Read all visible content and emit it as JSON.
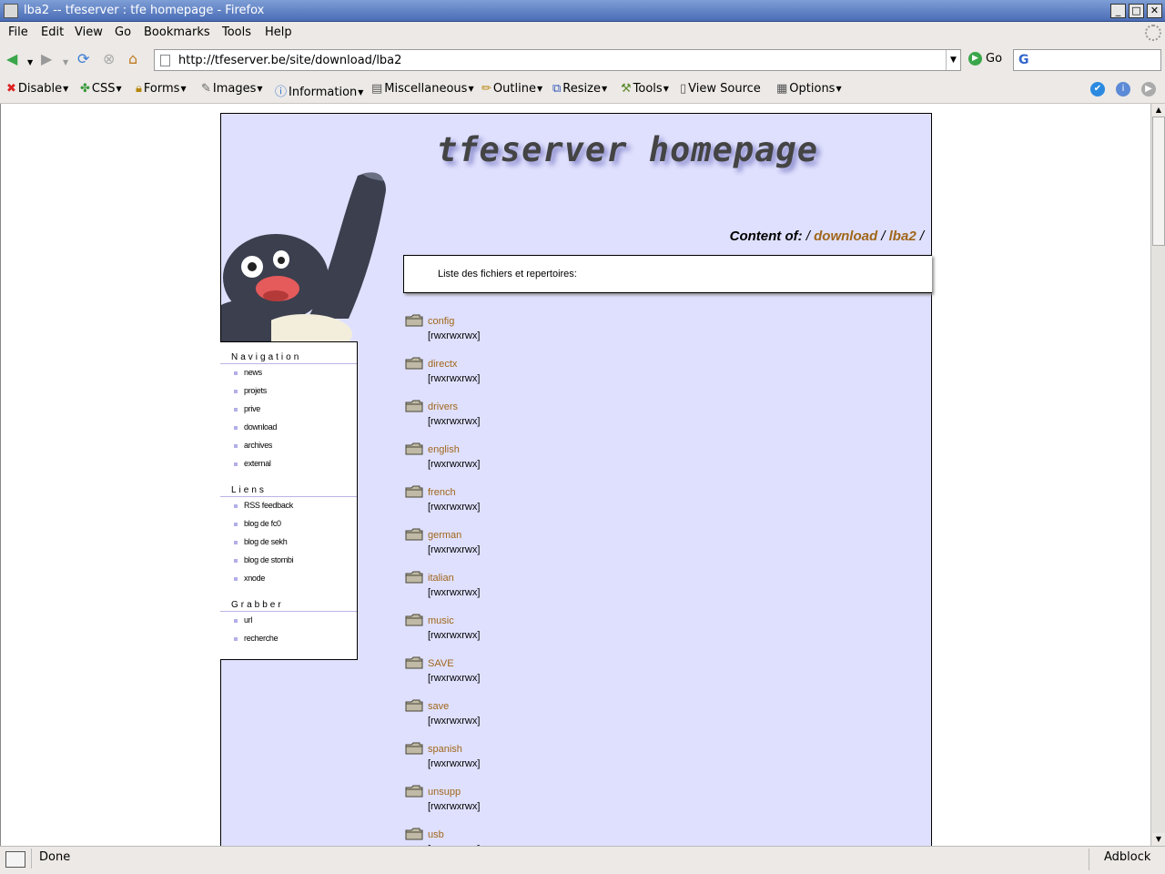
{
  "window": {
    "title": "lba2 -- tfeserver : tfe homepage - Firefox"
  },
  "menu": [
    "File",
    "Edit",
    "View",
    "Go",
    "Bookmarks",
    "Tools",
    "Help"
  ],
  "navbar": {
    "url": "http://tfeserver.be/site/download/lba2",
    "go_label": "Go",
    "search_engine_letter": "G"
  },
  "webdev_toolbar": [
    "Disable",
    "CSS",
    "Forms",
    "Images",
    "Information",
    "Miscellaneous",
    "Outline",
    "Resize",
    "Tools",
    "View Source",
    "Options"
  ],
  "page": {
    "site_title": "tfeserver homepage",
    "crumb_label": "Content of:",
    "crumb_links": [
      "download",
      "lba2"
    ],
    "list_header": "Liste des fichiers et repertoires:",
    "sidebar": {
      "sections": [
        {
          "title": "Navigation",
          "items": [
            "news",
            "projets",
            "prive",
            "download",
            "archives",
            "external"
          ]
        },
        {
          "title": "Liens",
          "items": [
            "RSS feedback",
            "blog de fc0",
            "blog de sekh",
            "blog de stombi",
            "xnode"
          ]
        },
        {
          "title": "Grabber",
          "items": [
            "url",
            "recherche"
          ]
        }
      ]
    },
    "files": [
      {
        "name": "config",
        "perm": "[rwxrwxrwx]"
      },
      {
        "name": "directx",
        "perm": "[rwxrwxrwx]"
      },
      {
        "name": "drivers",
        "perm": "[rwxrwxrwx]"
      },
      {
        "name": "english",
        "perm": "[rwxrwxrwx]"
      },
      {
        "name": "french",
        "perm": "[rwxrwxrwx]"
      },
      {
        "name": "german",
        "perm": "[rwxrwxrwx]"
      },
      {
        "name": "italian",
        "perm": "[rwxrwxrwx]"
      },
      {
        "name": "music",
        "perm": "[rwxrwxrwx]"
      },
      {
        "name": "SAVE",
        "perm": "[rwxrwxrwx]"
      },
      {
        "name": "save",
        "perm": "[rwxrwxrwx]"
      },
      {
        "name": "spanish",
        "perm": "[rwxrwxrwx]"
      },
      {
        "name": "unsupp",
        "perm": "[rwxrwxrwx]"
      },
      {
        "name": "usb",
        "perm": "[rwxrwxrwx]"
      }
    ]
  },
  "status": {
    "text": "Done",
    "adblock": "Adblock"
  },
  "colors": {
    "page_bg": "#dfe0fd",
    "link": "#a0661a",
    "titlebar": "#4a6cb5"
  }
}
